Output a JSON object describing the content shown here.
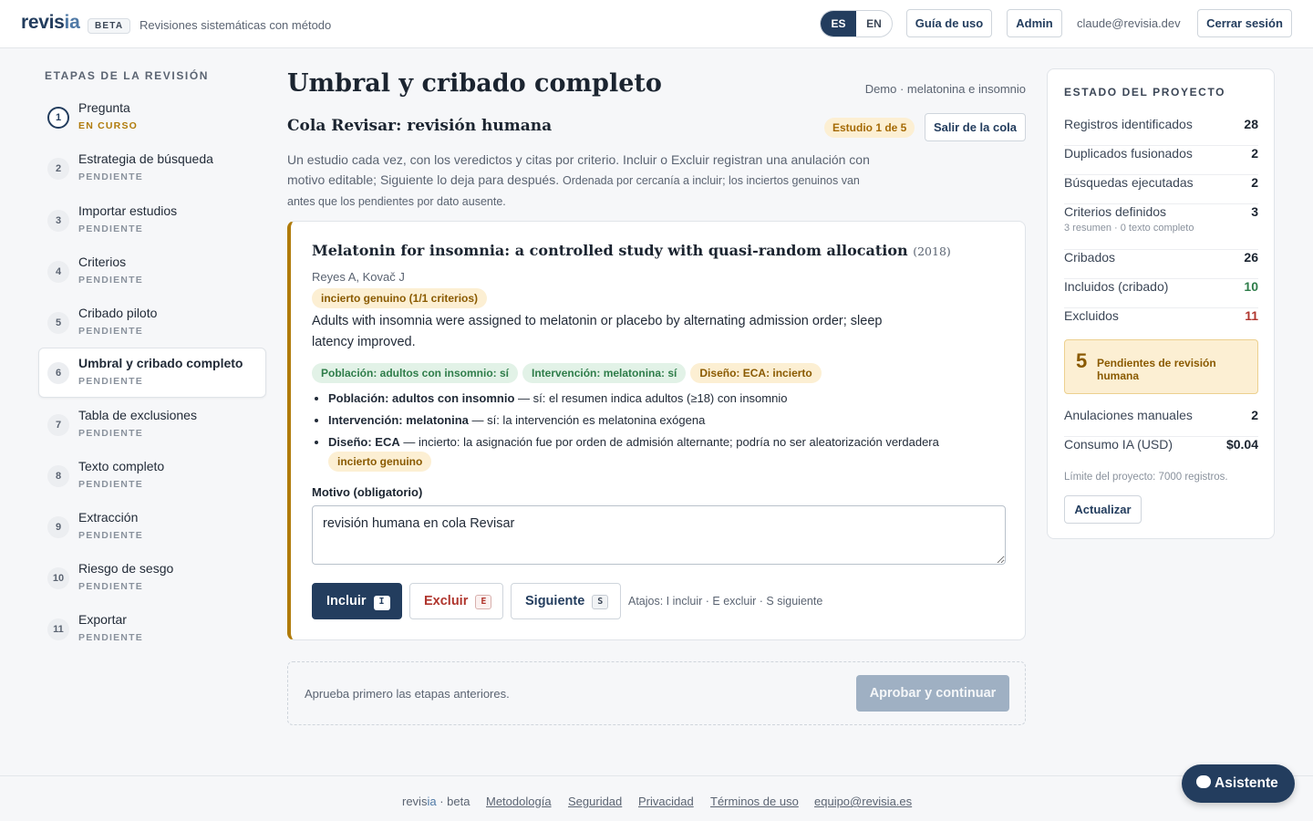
{
  "header": {
    "logo_main": "revis",
    "logo_accent": "ia",
    "beta": "BETA",
    "tagline": "Revisiones sistemáticas con método",
    "lang_es": "ES",
    "lang_en": "EN",
    "guide": "Guía de uso",
    "admin": "Admin",
    "email": "claude@revisia.dev",
    "logout": "Cerrar sesión"
  },
  "sidebar": {
    "title": "ETAPAS DE LA REVISIÓN",
    "steps": [
      {
        "num": "1",
        "label": "Pregunta",
        "status": "EN CURSO"
      },
      {
        "num": "2",
        "label": "Estrategia de búsqueda",
        "status": "PENDIENTE"
      },
      {
        "num": "3",
        "label": "Importar estudios",
        "status": "PENDIENTE"
      },
      {
        "num": "4",
        "label": "Criterios",
        "status": "PENDIENTE"
      },
      {
        "num": "5",
        "label": "Cribado piloto",
        "status": "PENDIENTE"
      },
      {
        "num": "6",
        "label": "Umbral y cribado completo",
        "status": "PENDIENTE"
      },
      {
        "num": "7",
        "label": "Tabla de exclusiones",
        "status": "PENDIENTE"
      },
      {
        "num": "8",
        "label": "Texto completo",
        "status": "PENDIENTE"
      },
      {
        "num": "9",
        "label": "Extracción",
        "status": "PENDIENTE"
      },
      {
        "num": "10",
        "label": "Riesgo de sesgo",
        "status": "PENDIENTE"
      },
      {
        "num": "11",
        "label": "Exportar",
        "status": "PENDIENTE"
      }
    ]
  },
  "main": {
    "title": "Umbral y cribado completo",
    "project": "Demo · melatonina e insomnio",
    "queue_title": "Cola Revisar: revisión humana",
    "study_counter": "Estudio 1 de 5",
    "exit_queue": "Salir de la cola",
    "desc_main": "Un estudio cada vez, con los veredictos y citas por criterio. Incluir o Excluir registran una anulación con motivo editable; Siguiente lo deja para después.",
    "desc_small": "Ordenada por cercanía a incluir; los inciertos genuinos van antes que los pendientes por dato ausente.",
    "study": {
      "title": "Melatonin for insomnia: a controlled study with quasi-random allocation",
      "year": "(2018)",
      "authors": "Reyes A, Kovač J",
      "uncertain_badge": "incierto genuino (1/1 criterios)",
      "abstract": "Adults with insomnia were assigned to melatonin or placebo by alternating admission order; sleep latency improved.",
      "verdicts": [
        {
          "text": "Población: adultos con insomnio: sí",
          "kind": "ok"
        },
        {
          "text": "Intervención: melatonina: sí",
          "kind": "ok"
        },
        {
          "text": "Diseño: ECA: incierto",
          "kind": "warn"
        }
      ],
      "reasons": [
        {
          "criterion": "Población: adultos con insomnio",
          "text": " — sí: el resumen indica adultos (≥18) con insomnio"
        },
        {
          "criterion": "Intervención: melatonina",
          "text": " — sí: la intervención es melatonina exógena"
        },
        {
          "criterion": "Diseño: ECA",
          "text": " — incierto: la asignación fue por orden de admisión alternante; podría no ser aleatorización verdadera"
        }
      ],
      "reason_badge": "incierto genuino"
    },
    "motivo_label": "Motivo (obligatorio)",
    "motivo_value": "revisión humana en cola Revisar",
    "include": "Incluir",
    "include_key": "I",
    "exclude": "Excluir",
    "exclude_key": "E",
    "next": "Siguiente",
    "next_key": "S",
    "shortcuts": "Atajos: I incluir · E excluir · S siguiente",
    "approve_msg": "Aprueba primero las etapas anteriores.",
    "approve_btn": "Aprobar y continuar"
  },
  "panel": {
    "title": "ESTADO DEL PROYECTO",
    "stats": [
      {
        "k": "Registros identificados",
        "v": "28"
      },
      {
        "k": "Duplicados fusionados",
        "v": "2"
      },
      {
        "k": "Búsquedas ejecutadas",
        "v": "2"
      },
      {
        "k": "Criterios definidos",
        "v": "3",
        "note": "3 resumen · 0 texto completo"
      },
      {
        "k": "Cribados",
        "v": "26"
      },
      {
        "k": "Incluidos (cribado)",
        "v": "10"
      },
      {
        "k": "Excluidos",
        "v": "11"
      }
    ],
    "pending_num": "5",
    "pending_text": "Pendientes de revisión humana",
    "overrides_k": "Anulaciones manuales",
    "overrides_v": "2",
    "cost_k": "Consumo IA (USD)",
    "cost_v": "$0.04",
    "limit": "Límite del proyecto: 7000 registros.",
    "refresh": "Actualizar"
  },
  "footer": {
    "brand_main": "revis",
    "brand_accent": "ia",
    "brand_suffix": " · beta",
    "links": [
      "Metodología",
      "Seguridad",
      "Privacidad",
      "Términos de uso",
      "equipo@revisia.es"
    ]
  },
  "assistant": "Asistente",
  "colors": {
    "brand": "#233d5e",
    "warning": "#b07b0a",
    "success": "#2f7d4a",
    "danger": "#b0362e"
  }
}
